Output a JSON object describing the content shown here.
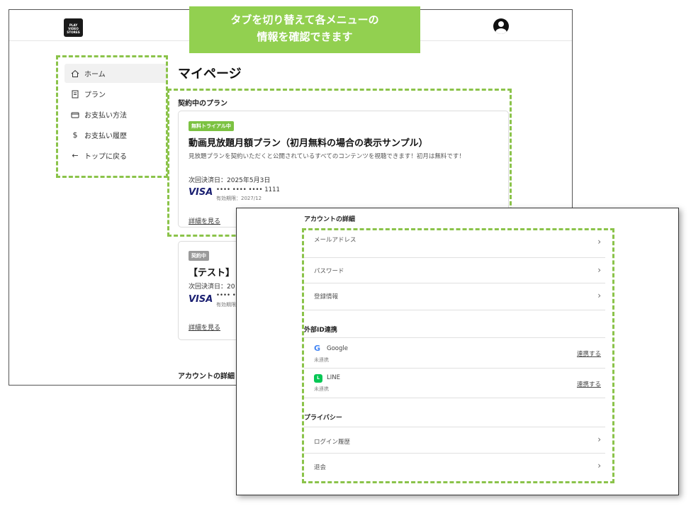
{
  "callout": {
    "line1": "タブを切り替えて各メニューの",
    "line2": "情報を確認できます"
  },
  "header": {
    "logo_text": "PLAY VIDEO STORES"
  },
  "sidebar": {
    "items": [
      {
        "label": "ホーム",
        "icon": "home-icon"
      },
      {
        "label": "プラン",
        "icon": "document-icon"
      },
      {
        "label": "お支払い方法",
        "icon": "wallet-icon"
      },
      {
        "label": "お支払い履歴",
        "icon": "dollar-icon"
      },
      {
        "label": "トップに戻る",
        "icon": "arrow-left-icon"
      }
    ]
  },
  "main": {
    "title": "マイページ",
    "contract_section": "契約中のプラン",
    "plans": [
      {
        "badge": "無料トライアル中",
        "title": "動画見放題月額プラン（初月無料の場合の表示サンプル）",
        "description": "見放題プランを契約いただくと公開されているすべてのコンテンツを視聴できます！初月は無料です！",
        "next_billing": "次回決済日：2025年5月3日",
        "card_brand": "VISA",
        "card_number": "•••• •••• •••• 1111",
        "expiry": "有効期限：2027/12",
        "detail_link": "詳細を見る"
      },
      {
        "badge": "契約中",
        "title": "【テスト】",
        "next_billing": "次回決済日：20",
        "card_brand": "VISA",
        "card_number": "•••• ••",
        "expiry": "有効期限",
        "detail_link": "詳細を見る"
      }
    ],
    "account_section_cut": "アカウントの詳細"
  },
  "overlay": {
    "account_section": "アカウントの詳細",
    "account_rows": [
      {
        "label": "メールアドレス"
      },
      {
        "label": "パスワード"
      },
      {
        "label": "登録情報"
      }
    ],
    "external_section": "外部ID連携",
    "external_rows": [
      {
        "name": "Google",
        "status": "未連携",
        "action": "連携する"
      },
      {
        "name": "LINE",
        "status": "未連携",
        "action": "連携する"
      }
    ],
    "privacy_section": "プライバシー",
    "privacy_rows": [
      {
        "label": "ログイン履歴"
      },
      {
        "label": "退会"
      }
    ]
  },
  "colors": {
    "accent_green": "#92d050",
    "dash_green": "#8bc34a",
    "visa_blue": "#1a1f71"
  }
}
